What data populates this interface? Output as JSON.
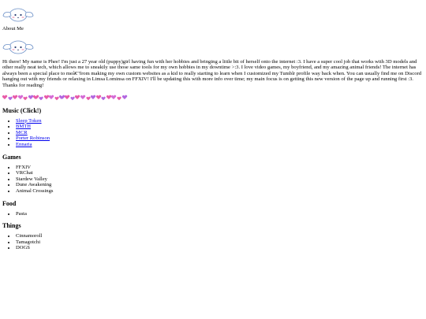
{
  "header": {
    "about_label": "About Me"
  },
  "bio": "Hi there! My name is Phee! I'm just a 27 year old (puppy)girl having fun with her hobbies and bringing a little bit of herself onto the internet :3. I have a super cool job that works with 3D models and other really neat tech, which allows me to sneakily use those same tools for my own hobbies in my downtime >:3. I love video games, my boyfriend, and my amazing animal friends! The internet has always been a special place to meâ€\"from making my own custom websites as a kid to really starting to learn when I customized my Tumblr profile way back when. You can usually find me on Discord hanging out with my friends or relaxing in Limsa Lominsa on FFXIV! I'll be updating this with more info over time; my main focus is on getting this new version of the page up and running first :3. Thanks for reading!",
  "hearts": {
    "count": 24,
    "colors": [
      "#e85aa8",
      "#b266e0",
      "#e85aa8",
      "#d46bd6",
      "#e85aa8",
      "#b266e0"
    ]
  },
  "music": {
    "heading": "Music (Click!)",
    "items": [
      "Sleep Token",
      "BMTH",
      "MCR",
      "Porter Robinson",
      "Ennaria"
    ]
  },
  "games": {
    "heading": "Games",
    "items": [
      "FFXIV",
      "VRChat",
      "Stardew Valley",
      "Dune Awakening",
      "Animal Crossings"
    ]
  },
  "food": {
    "heading": "Food",
    "items": [
      "Pasta"
    ]
  },
  "things": {
    "heading": "Things",
    "items": [
      "Cinnamoroll",
      "Tamagotchi",
      "DOGS"
    ]
  }
}
